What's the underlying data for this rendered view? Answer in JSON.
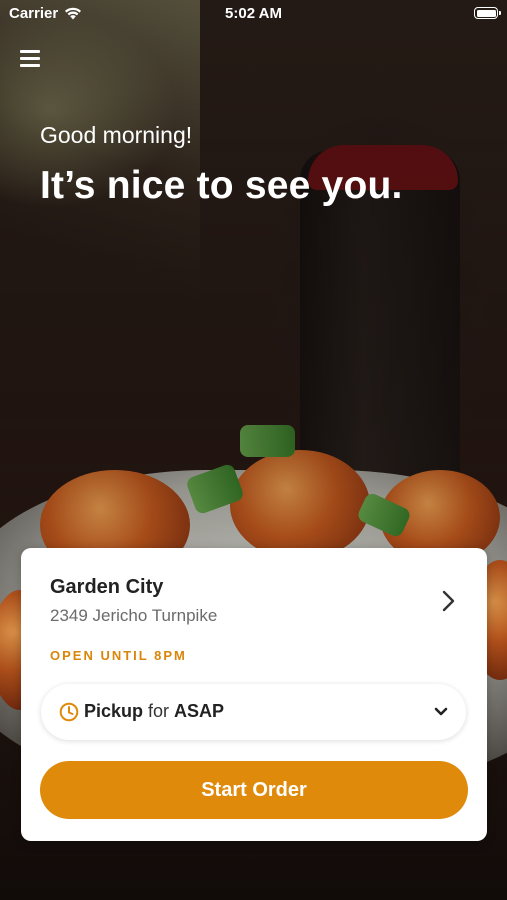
{
  "status_bar": {
    "carrier": "Carrier",
    "time": "5:02 AM"
  },
  "greeting": {
    "subtitle": "Good morning!",
    "headline": "It’s nice to see you."
  },
  "location": {
    "name": "Garden City",
    "address": "2349 Jericho Turnpike",
    "hours_status": "OPEN UNTIL 8PM"
  },
  "order_type": {
    "method": "Pickup",
    "connector": "for",
    "time": "ASAP"
  },
  "start_order_label": "Start Order",
  "colors": {
    "accent": "#e08a0c",
    "status_text": "#d9860a"
  },
  "icons": {
    "menu": "hamburger-menu-icon",
    "wifi": "wifi-icon",
    "battery": "battery-icon",
    "location_nav": "chevron-right-icon",
    "clock": "clock-icon",
    "dropdown": "chevron-down-icon"
  }
}
